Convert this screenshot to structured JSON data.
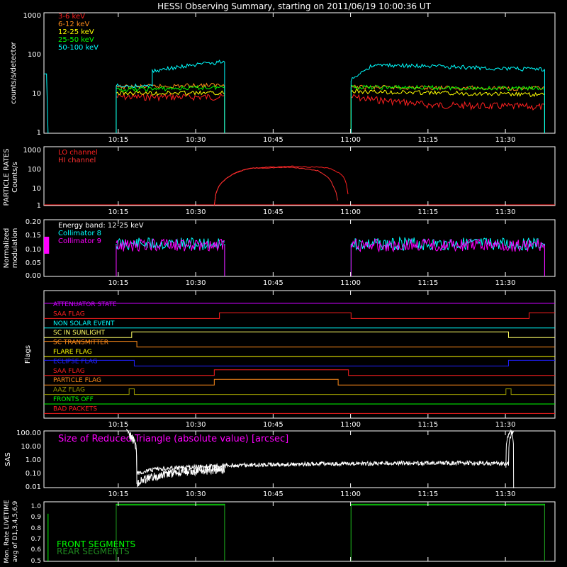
{
  "title": "HESSI Observing Summary, starting on 2011/06/19 10:00:36 UT",
  "time_axis": {
    "range_minutes": [
      0,
      99
    ],
    "ticks": [
      {
        "t": 14.4,
        "label": "10:15"
      },
      {
        "t": 29.4,
        "label": "10:30"
      },
      {
        "t": 44.4,
        "label": "10:45"
      },
      {
        "t": 59.4,
        "label": "11:00"
      },
      {
        "t": 74.4,
        "label": "11:15"
      },
      {
        "t": 89.4,
        "label": "11:30"
      }
    ]
  },
  "panels": {
    "rates": {
      "ylabel": "counts/s/detector",
      "ticks": [
        "1000",
        "100",
        "10",
        "1"
      ],
      "legend": [
        {
          "label": "3-6 keV",
          "color": "#ff2020"
        },
        {
          "label": "6-12 keV",
          "color": "#ff8c1a"
        },
        {
          "label": "12-25 keV",
          "color": "#ffff00"
        },
        {
          "label": "25-50 keV",
          "color": "#00ff00"
        },
        {
          "label": "50-100 keV",
          "color": "#00ffff"
        }
      ]
    },
    "particle": {
      "ylabel_1": "PARTICLE RATES",
      "ylabel_2": "Counts/s",
      "ticks": [
        "1000",
        "100",
        "10",
        "1"
      ],
      "legend": [
        {
          "label": "LO channel",
          "color": "#ff2020"
        },
        {
          "label": "HI channel",
          "color": "#ff3030"
        }
      ]
    },
    "modulation": {
      "ylabel_1": "Normalized",
      "ylabel_2": "modulation",
      "ticks": [
        "0.20",
        "0.15",
        "0.10",
        "0.05",
        "0.00"
      ],
      "legend": [
        {
          "label": "Energy band: 12-25 keV",
          "color": "#ffffff"
        },
        {
          "label": "Collimator 8",
          "color": "#00ffff"
        },
        {
          "label": "Collimator 9",
          "color": "#ff00ff"
        }
      ]
    },
    "flags": {
      "ylabel": "Flags",
      "items": [
        {
          "label": "ATTENUATOR STATE",
          "color": "#cc00ff"
        },
        {
          "label": "SAA FLAG",
          "color": "#ff2020"
        },
        {
          "label": "NON SOLAR EVENT",
          "color": "#00ffff"
        },
        {
          "label": "SC IN SUNLIGHT",
          "color": "#ffff66"
        },
        {
          "label": "SC TRANSMITTER",
          "color": "#ff8c1a"
        },
        {
          "label": "FLARE FLAG",
          "color": "#ffff00"
        },
        {
          "label": "ECLIPSE FLAG",
          "color": "#2020ff"
        },
        {
          "label": "SAA FLAG",
          "color": "#ff2020"
        },
        {
          "label": "PARTICLE FLAG",
          "color": "#ff8c1a"
        },
        {
          "label": "AAZ FLAG",
          "color": "#999900"
        },
        {
          "label": "FRONTS OFF",
          "color": "#00ff00"
        },
        {
          "label": "BAD PACKETS",
          "color": "#ff2020"
        }
      ]
    },
    "sas": {
      "ylabel": "SAS",
      "label": "Size of Reduced Triangle (absolute value) [arcsec]",
      "label_color": "#ff00ff",
      "ticks": [
        "100.00",
        "10.00",
        "1.00",
        "0.10",
        "0.01"
      ]
    },
    "livetime": {
      "ylabel_1": "Mon. Rate LIVETIME",
      "ylabel_2": "avg of D1,3,4,5,6,9",
      "ticks": [
        "1.0",
        "0.9",
        "0.8",
        "0.7",
        "0.6",
        "0.5"
      ],
      "legend": [
        {
          "label": "FRONT SEGMENTS",
          "color": "#00ff00"
        },
        {
          "label": "REAR SEGMENTS",
          "color": "#1f8a1f"
        }
      ]
    }
  },
  "chart_data": [
    {
      "type": "line",
      "name": "count rates",
      "yscale": "log",
      "ylim": [
        1,
        1000
      ],
      "observation_intervals_min": [
        [
          0,
          1
        ],
        [
          14,
          35
        ],
        [
          59.5,
          97
        ]
      ],
      "series": [
        {
          "name": "3-6 keV",
          "values": [
            [
              14,
              8
            ],
            [
              35,
              8
            ],
            [
              59.5,
              8
            ],
            [
              63,
              7
            ],
            [
              75,
              5
            ],
            [
              97,
              4.5
            ]
          ]
        },
        {
          "name": "6-12 keV",
          "values": [
            [
              14,
              14
            ],
            [
              35,
              16
            ],
            [
              59.5,
              14
            ],
            [
              97,
              13
            ]
          ]
        },
        {
          "name": "12-25 keV",
          "values": [
            [
              14,
              10
            ],
            [
              35,
              10
            ],
            [
              59.5,
              11
            ],
            [
              97,
              9
            ]
          ]
        },
        {
          "name": "25-50 keV",
          "values": [
            [
              14,
              12
            ],
            [
              35,
              14
            ],
            [
              59.5,
              14
            ],
            [
              97,
              13
            ]
          ]
        },
        {
          "name": "50-100 keV",
          "values": [
            [
              14,
              15
            ],
            [
              21,
              15
            ],
            [
              21,
              35
            ],
            [
              35,
              60
            ],
            [
              59.5,
              20
            ],
            [
              64,
              50
            ],
            [
              97,
              38
            ]
          ]
        }
      ]
    },
    {
      "type": "line",
      "name": "particle rates",
      "yscale": "log",
      "ylim": [
        1,
        1000
      ],
      "series": [
        {
          "name": "LO channel",
          "values": [
            [
              33,
              1
            ],
            [
              35,
              20
            ],
            [
              40,
              80
            ],
            [
              48,
              100
            ],
            [
              55,
              85
            ],
            [
              58,
              30
            ],
            [
              59,
              1
            ]
          ]
        },
        {
          "name": "HI channel",
          "values": [
            [
              33,
              1
            ],
            [
              35,
              20
            ],
            [
              40,
              80
            ],
            [
              48,
              90
            ],
            [
              53,
              60
            ],
            [
              56,
              10
            ],
            [
              57,
              1
            ]
          ]
        }
      ]
    },
    {
      "type": "line",
      "name": "normalized modulation",
      "ylim": [
        0,
        0.2
      ],
      "series": [
        {
          "name": "Collimator 8",
          "values": [
            [
              14,
              0.115
            ],
            [
              35,
              0.115
            ],
            [
              59.5,
              0.115
            ],
            [
              97,
              0.115
            ]
          ]
        },
        {
          "name": "Collimator 9",
          "values": [
            [
              14,
              0.11
            ],
            [
              35,
              0.11
            ],
            [
              59.5,
              0.11
            ],
            [
              97,
              0.11
            ]
          ]
        }
      ]
    },
    {
      "type": "line",
      "name": "SAS reduced triangle size",
      "yscale": "log",
      "ylim": [
        0.01,
        100
      ],
      "series": [
        {
          "name": "Size of Reduced Triangle",
          "values": [
            [
              16,
              100
            ],
            [
              18,
              0.1
            ],
            [
              22,
              0.2
            ],
            [
              30,
              0.3
            ],
            [
              40,
              0.4
            ],
            [
              60,
              0.5
            ],
            [
              85,
              0.55
            ],
            [
              90,
              0.5
            ],
            [
              91,
              100
            ]
          ]
        }
      ]
    },
    {
      "type": "line",
      "name": "livetime",
      "ylim": [
        0.5,
        1.0
      ],
      "series": [
        {
          "name": "FRONT SEGMENTS",
          "values": [
            [
              14,
              0.98
            ],
            [
              35,
              0.98
            ],
            [
              59.5,
              0.98
            ],
            [
              97,
              0.98
            ]
          ]
        },
        {
          "name": "REAR SEGMENTS",
          "values": [
            [
              14,
              0.97
            ],
            [
              35,
              0.97
            ],
            [
              59.5,
              0.97
            ],
            [
              97,
              0.97
            ]
          ]
        }
      ]
    }
  ]
}
